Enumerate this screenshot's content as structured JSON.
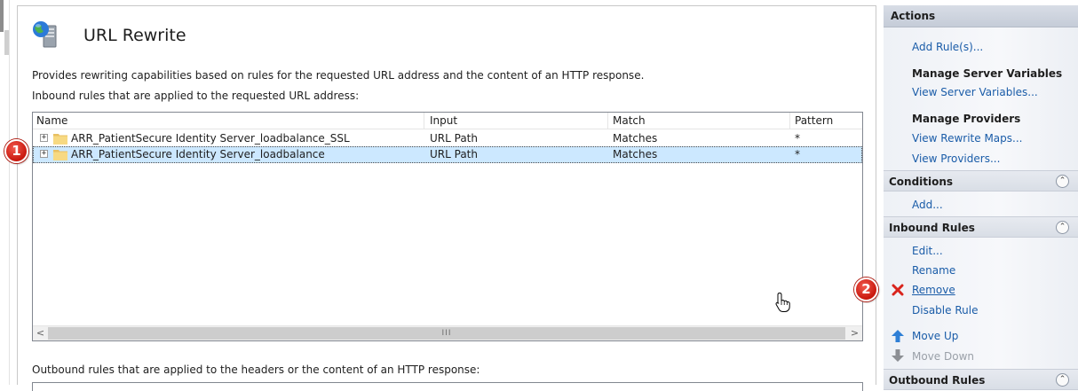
{
  "main": {
    "title": "URL Rewrite",
    "description": "Provides rewriting capabilities based on rules for the requested URL address and the content of an HTTP response.",
    "inbound_label": "Inbound rules that are applied to the requested URL address:",
    "outbound_label": "Outbound rules that are applied to the headers or the content of an HTTP response:",
    "table": {
      "columns": [
        "Name",
        "Input",
        "Match",
        "Pattern"
      ],
      "rows": [
        {
          "expander": "+",
          "name": "ARR_PatientSecure Identity Server_loadbalance_SSL",
          "input": "URL Path",
          "match": "Matches",
          "pattern": "*"
        },
        {
          "expander": "+",
          "name": "ARR_PatientSecure Identity Server_loadbalance",
          "input": "URL Path",
          "match": "Matches",
          "pattern": "*"
        }
      ],
      "scroll_left": "<",
      "scroll_right": ">",
      "scroll_grip": "III"
    }
  },
  "actions": {
    "header": "Actions",
    "add_rules": "Add Rule(s)...",
    "manage_server_variables": "Manage Server Variables",
    "view_server_variables": "View Server Variables...",
    "manage_providers": "Manage Providers",
    "view_rewrite_maps": "View Rewrite Maps...",
    "view_providers": "View Providers...",
    "conditions": {
      "title": "Conditions",
      "add": "Add..."
    },
    "inbound_rules": {
      "title": "Inbound Rules",
      "edit": "Edit...",
      "rename": "Rename",
      "remove": "Remove",
      "disable": "Disable Rule",
      "move_up": "Move Up",
      "move_down": "Move Down"
    },
    "outbound_rules": {
      "title": "Outbound Rules"
    },
    "collapse_glyph": "⌃"
  },
  "badges": {
    "one": "1",
    "two": "2"
  },
  "colors": {
    "link": "#1a5ca8",
    "selection": "#cce8ff",
    "badge": "#d2251a",
    "remove_icon": "#d9241c",
    "move_icon": "#2e7fd6"
  }
}
